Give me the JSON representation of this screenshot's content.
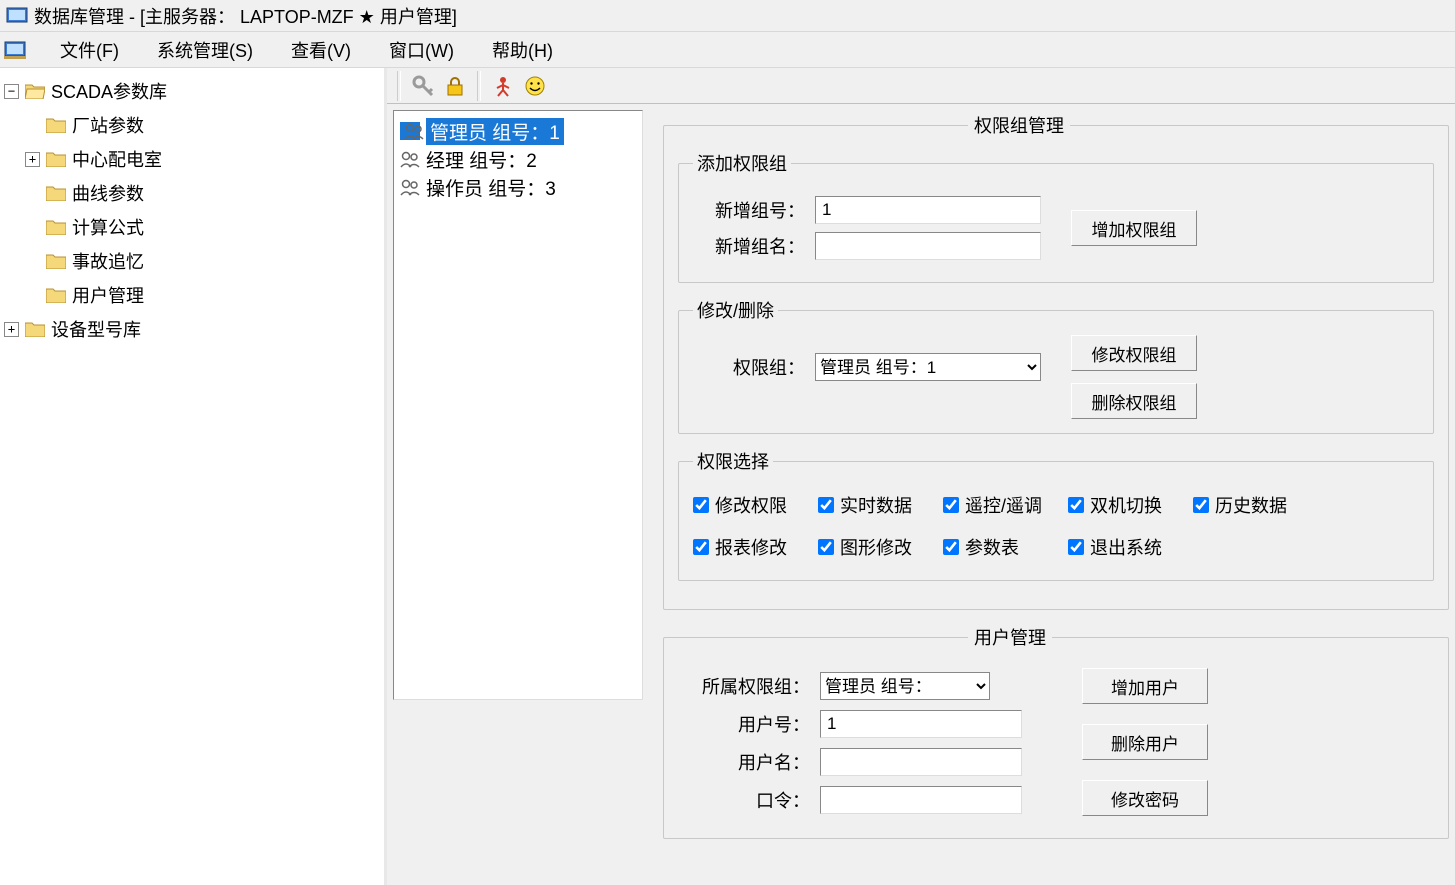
{
  "title": "数据库管理 - [主服务器：  LAPTOP-MZF ★ 用户管理]",
  "menu": {
    "file": "文件(F)",
    "system": "系统管理(S)",
    "view": "查看(V)",
    "window": "窗口(W)",
    "help": "帮助(H)"
  },
  "tree": {
    "root1": "SCADA参数库",
    "root1_children": {
      "c1": "厂站参数",
      "c2": "中心配电室",
      "c3": "曲线参数",
      "c4": "计算公式",
      "c5": "事故追忆",
      "c6": "用户管理"
    },
    "root2": "设备型号库"
  },
  "user_list": [
    {
      "label": "管理员 组号：1",
      "selected": true
    },
    {
      "label": "经理 组号：2",
      "selected": false
    },
    {
      "label": "操作员 组号：3",
      "selected": false
    }
  ],
  "group_mgmt": {
    "title": "权限组管理",
    "add_group": {
      "title": "添加权限组",
      "new_id_label": "新增组号：",
      "new_id_value": "1",
      "new_name_label": "新增组名：",
      "new_name_value": "",
      "add_btn": "增加权限组"
    },
    "edit_group": {
      "title": "修改/删除",
      "label": "权限组：",
      "selected": "管理员 组号：1",
      "modify_btn": "修改权限组",
      "delete_btn": "删除权限组"
    },
    "perm_select": {
      "title": "权限选择",
      "items": [
        "修改权限",
        "实时数据",
        "遥控/遥调",
        "双机切换",
        "历史数据",
        "报表修改",
        "图形修改",
        "参数表",
        "退出系统"
      ]
    }
  },
  "user_mgmt": {
    "title": "用户管理",
    "group_label": "所属权限组：",
    "group_selected": "管理员 组号：",
    "user_id_label": "用户号：",
    "user_id_value": "1",
    "user_name_label": "用户名：",
    "user_name_value": "",
    "pw_label": "口令：",
    "pw_value": "",
    "add_btn": "增加用户",
    "delete_btn": "删除用户",
    "modify_pw_btn": "修改密码"
  }
}
